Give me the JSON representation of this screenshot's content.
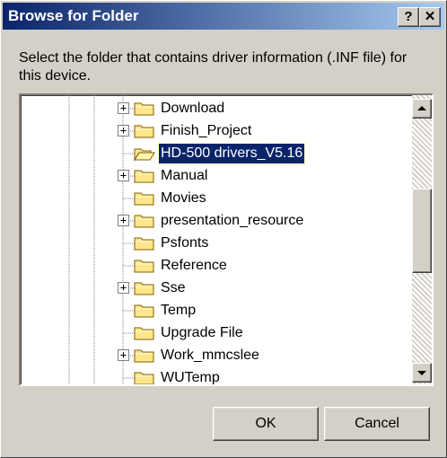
{
  "dialog": {
    "title": "Browse for Folder",
    "help_label": "?",
    "close_label": "✕",
    "instruction": "Select the folder that contains driver information (.INF file) for this device.",
    "ok_label": "OK",
    "cancel_label": "Cancel"
  },
  "tree": {
    "items": [
      {
        "label": "Download",
        "expander": "+",
        "selected": false
      },
      {
        "label": "Finish_Project",
        "expander": "+",
        "selected": false
      },
      {
        "label": "HD-500 drivers_V5.16",
        "expander": "",
        "selected": true,
        "open_folder": true
      },
      {
        "label": "Manual",
        "expander": "+",
        "selected": false
      },
      {
        "label": "Movies",
        "expander": "",
        "selected": false
      },
      {
        "label": "presentation_resource",
        "expander": "+",
        "selected": false
      },
      {
        "label": "Psfonts",
        "expander": "",
        "selected": false
      },
      {
        "label": "Reference",
        "expander": "",
        "selected": false
      },
      {
        "label": "Sse",
        "expander": "+",
        "selected": false
      },
      {
        "label": "Temp",
        "expander": "",
        "selected": false
      },
      {
        "label": "Upgrade File",
        "expander": "",
        "selected": false
      },
      {
        "label": "Work_mmcslee",
        "expander": "+",
        "selected": false
      },
      {
        "label": "WUTemp",
        "expander": "",
        "selected": false
      }
    ]
  },
  "colors": {
    "selection_bg": "#0a246a",
    "folder_fill": "#ffe68a",
    "folder_stroke": "#806000"
  },
  "icons": {
    "folder": "folder-icon",
    "open_folder": "open-folder-icon",
    "scroll_up": "scroll-up-arrow-icon",
    "scroll_down": "scroll-down-arrow-icon"
  }
}
